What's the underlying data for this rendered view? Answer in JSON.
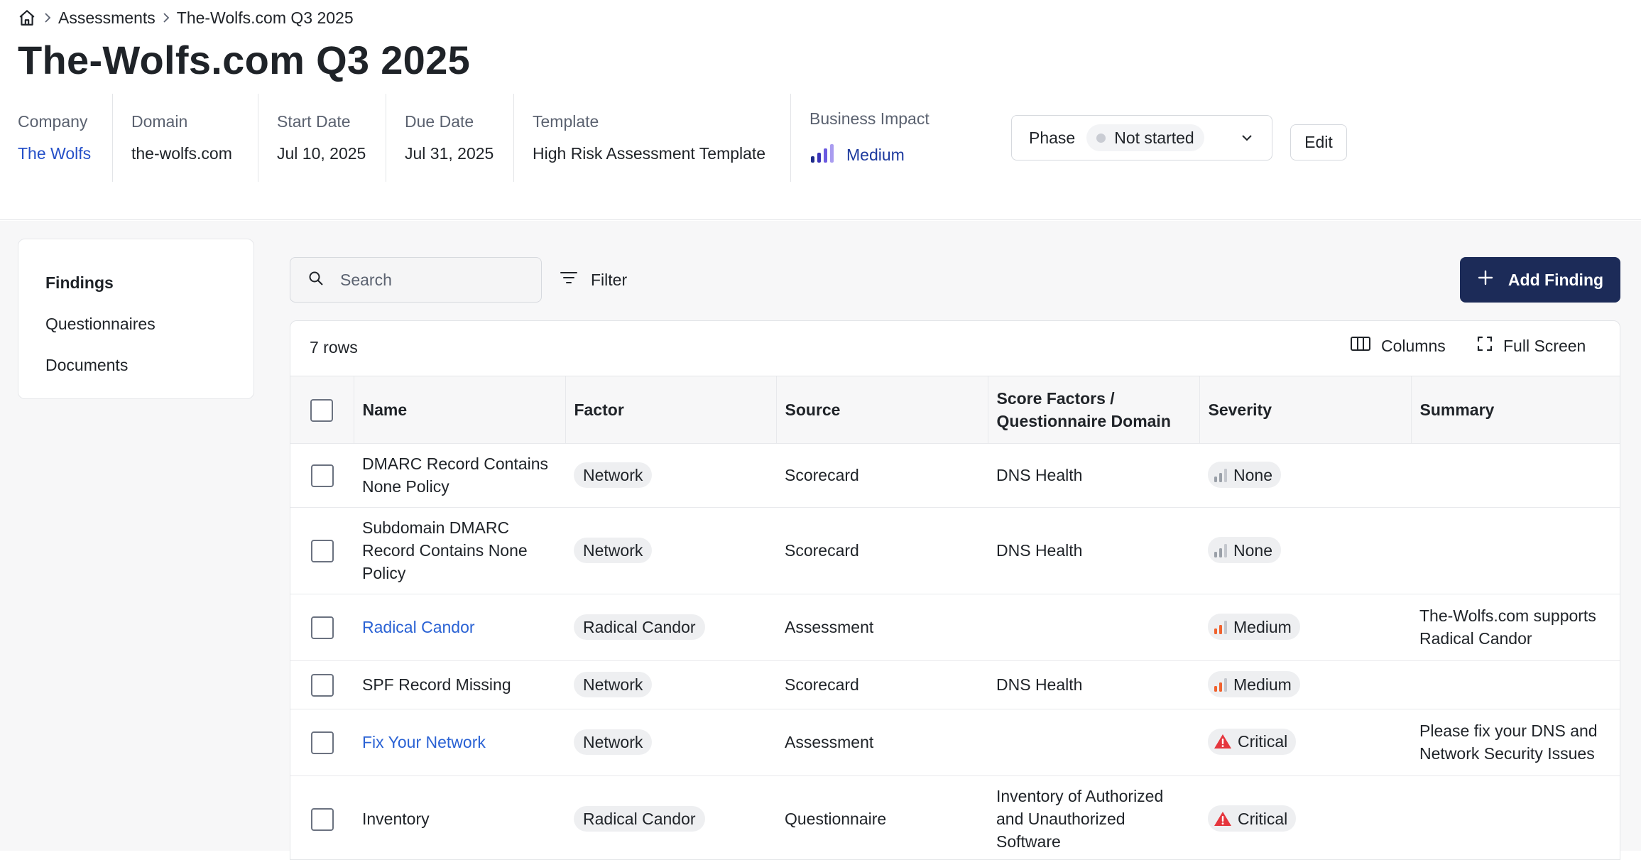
{
  "breadcrumb": {
    "items": [
      "Assessments",
      "The-Wolfs.com Q3 2025"
    ]
  },
  "page": {
    "title": "The-Wolfs.com Q3 2025"
  },
  "meta": {
    "company_label": "Company",
    "company_value": "The Wolfs",
    "domain_label": "Domain",
    "domain_value": "the-wolfs.com",
    "start_label": "Start Date",
    "start_value": "Jul 10, 2025",
    "due_label": "Due Date",
    "due_value": "Jul 31, 2025",
    "template_label": "Template",
    "template_value": "High Risk Assessment Template",
    "impact_label": "Business Impact",
    "impact_value": "Medium"
  },
  "phase": {
    "label": "Phase",
    "value": "Not started"
  },
  "edit_label": "Edit",
  "sidebar": {
    "items": [
      {
        "label": "Findings",
        "active": true
      },
      {
        "label": "Questionnaires",
        "active": false
      },
      {
        "label": "Documents",
        "active": false
      }
    ]
  },
  "toolbar": {
    "search_placeholder": "Search",
    "filter_label": "Filter",
    "add_label": "Add Finding",
    "row_count": "7 rows",
    "columns_label": "Columns",
    "fullscreen_label": "Full Screen"
  },
  "table": {
    "headers": [
      "Name",
      "Factor",
      "Source",
      "Score Factors / Questionnaire Domain",
      "Severity",
      "Summary"
    ],
    "rows": [
      {
        "name": "DMARC Record Contains None Policy",
        "link": false,
        "factor": "Network",
        "source": "Scorecard",
        "domain": "DNS Health",
        "severity": "None",
        "summary": ""
      },
      {
        "name": "Subdomain DMARC Record Contains None Policy",
        "link": false,
        "factor": "Network",
        "source": "Scorecard",
        "domain": "DNS Health",
        "severity": "None",
        "summary": ""
      },
      {
        "name": "Radical Candor",
        "link": true,
        "factor": "Radical Candor",
        "source": "Assessment",
        "domain": "",
        "severity": "Medium",
        "summary": "The-Wolfs.com supports Radical Candor"
      },
      {
        "name": "SPF Record Missing",
        "link": false,
        "factor": "Network",
        "source": "Scorecard",
        "domain": "DNS Health",
        "severity": "Medium",
        "summary": ""
      },
      {
        "name": "Fix Your Network",
        "link": true,
        "factor": "Network",
        "source": "Assessment",
        "domain": "",
        "severity": "Critical",
        "summary": "Please fix your DNS and Network Security Issues"
      },
      {
        "name": "Inventory",
        "link": false,
        "factor": "Radical Candor",
        "source": "Questionnaire",
        "domain": "Inventory of Authorized and Unauthorized Software",
        "severity": "Critical",
        "summary": ""
      }
    ]
  },
  "colors": {
    "brand_navy": "#1c2b58",
    "link_blue": "#2a62d4",
    "impact_purple": "#5b3fd6",
    "severity_medium": "#f0622e",
    "severity_critical": "#e5363d"
  },
  "icons": [
    "home-icon",
    "chevron-right-icon",
    "chevron-down-icon",
    "search-icon",
    "filter-icon",
    "plus-icon",
    "columns-icon",
    "fullscreen-icon",
    "signal-bars-icon",
    "warning-icon"
  ]
}
